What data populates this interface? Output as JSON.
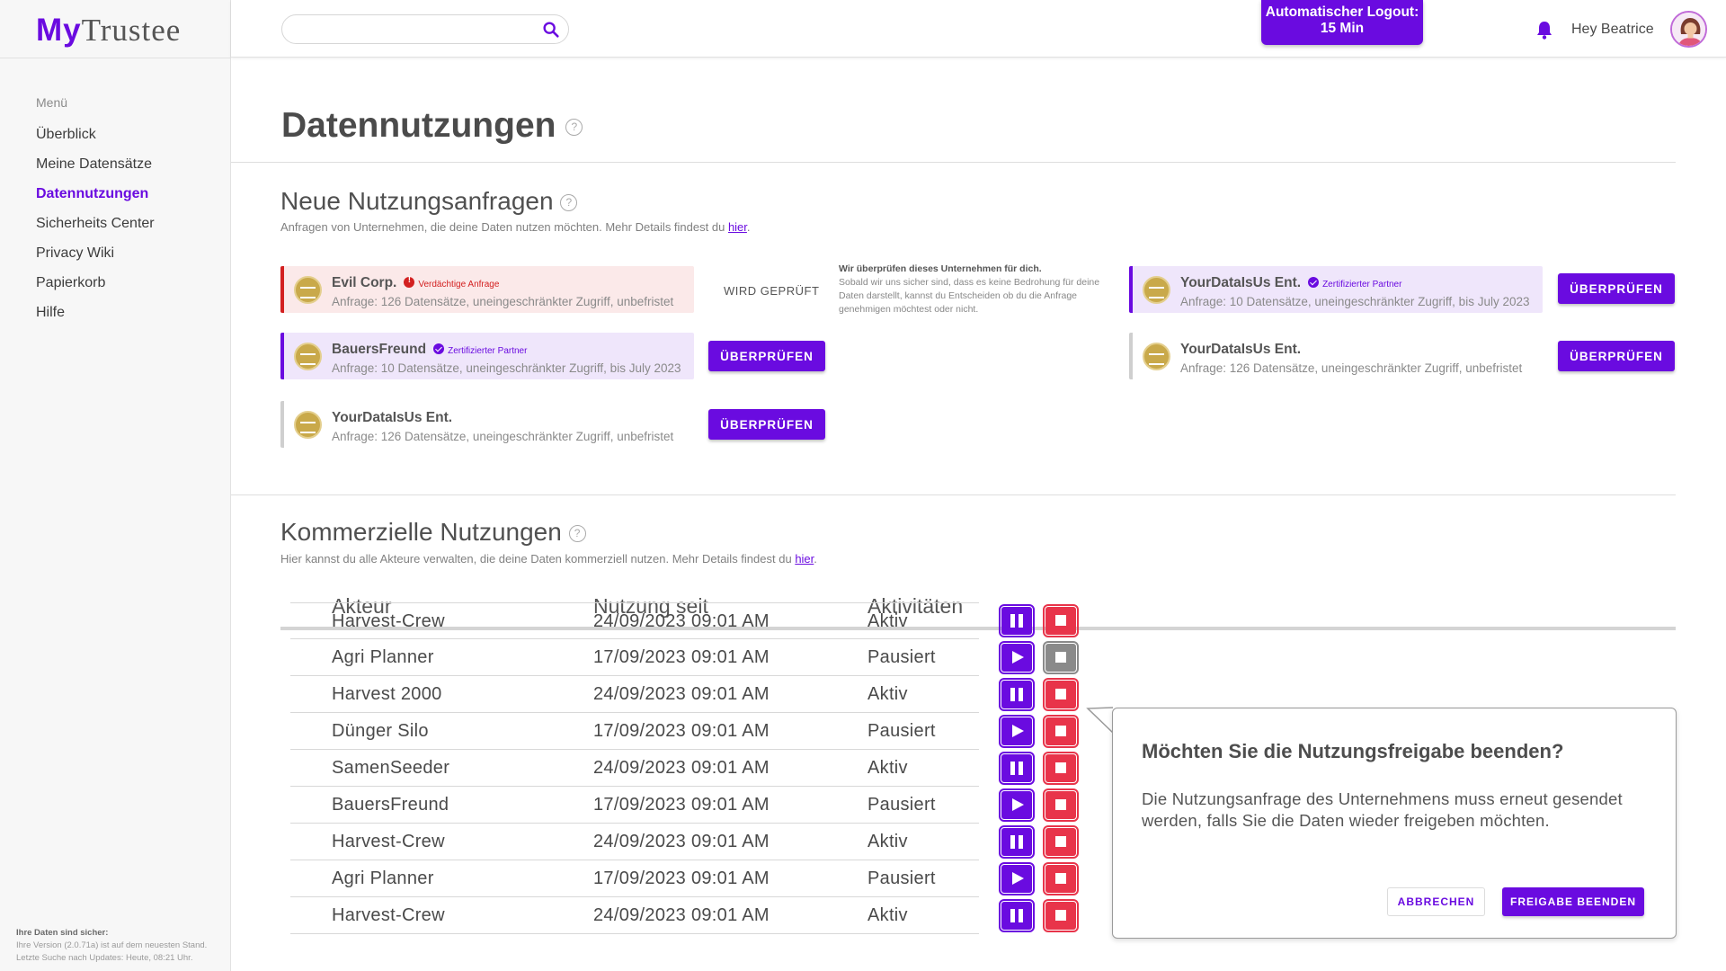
{
  "app": {
    "logo_my": "My",
    "logo_trustee": "Trustee"
  },
  "sidebar": {
    "menu_title": "Menü",
    "items": [
      {
        "label": "Überblick"
      },
      {
        "label": "Meine Datensätze"
      },
      {
        "label": "Datennutzungen"
      },
      {
        "label": "Sicherheits Center"
      },
      {
        "label": "Privacy Wiki"
      },
      {
        "label": "Papierkorb"
      },
      {
        "label": "Hilfe"
      }
    ],
    "active_item": "Datennutzungen",
    "footer": {
      "title": "Ihre Daten sind sicher:",
      "line1": "Ihre Version (2.0.71a) ist auf dem neuesten Stand.",
      "line2": "Letzte Suche nach Updates: Heute, 08:21 Uhr."
    }
  },
  "header": {
    "search_value": "",
    "search_icon": "search-icon",
    "logout_line1": "Automatischer Logout:",
    "logout_line2": "15 Min",
    "greeting": "Hey Beatrice",
    "bell_icon": "bell-icon"
  },
  "page": {
    "title": "Datennutzungen",
    "help": "?"
  },
  "requests": {
    "title": "Neue Nutzungsanfragen",
    "help": "?",
    "subtitle": "Anfragen von Unternehmen, die deine Daten nutzen möchten. Mehr Details findest du",
    "link": "hier",
    "subtitle_end": ".",
    "checking_label": "WIRD GEPRÜFT",
    "info_title": "Wir überprüfen dieses Unternehmen für dich.",
    "info_text": "Sobald wir uns sicher sind, dass es keine Bedrohung für deine Daten darstellt, kannst du Entscheiden ob du die Anfrage genehmigen möchtest oder nicht.",
    "button_label": "ÜBERPRÜFEN",
    "cards": [
      {
        "name": "Evil Corp.",
        "badge": "Verdächtige Anfrage",
        "badge_type": "warning",
        "desc": "Anfrage: 126 Datensätze, uneingeschränkter Zugriff, unbefristet"
      },
      {
        "name": "BauersFreund",
        "badge": "Zertifizierter Partner",
        "badge_type": "certified",
        "desc": "Anfrage: 10 Datensätze, uneingeschränkter Zugriff, bis July 2023"
      },
      {
        "name": "YourDataIsUs Ent.",
        "badge": "",
        "badge_type": "none",
        "desc": "Anfrage: 126 Datensätze, uneingeschränkter Zugriff, unbefristet"
      },
      {
        "name": "YourDataIsUs Ent.",
        "badge": "Zertifizierter Partner",
        "badge_type": "certified",
        "desc": "Anfrage: 10 Datensätze, uneingeschränkter Zugriff, bis July 2023"
      },
      {
        "name": "YourDataIsUs Ent.",
        "badge": "",
        "badge_type": "none",
        "desc": "Anfrage: 126 Datensätze, uneingeschränkter Zugriff, unbefristet"
      }
    ]
  },
  "commercial": {
    "title": "Kommerzielle Nutzungen",
    "help": "?",
    "subtitle": "Hier kannst du alle Akteure verwalten, die deine Daten kommerziell nutzen. Mehr Details findest du",
    "link": "hier",
    "subtitle_end": ".",
    "columns": [
      "Akteur",
      "Nutzung seit",
      "Aktivitäten"
    ],
    "rows": [
      {
        "actor": "Harvest-Crew",
        "since": "24/09/2023 09:01 AM",
        "status": "Aktiv"
      },
      {
        "actor": "Agri Planner",
        "since": "17/09/2023 09:01 AM",
        "status": "Pausiert"
      },
      {
        "actor": "Harvest 2000",
        "since": "24/09/2023 09:01 AM",
        "status": "Aktiv"
      },
      {
        "actor": "Dünger Silo",
        "since": "17/09/2023 09:01 AM",
        "status": "Pausiert"
      },
      {
        "actor": "SamenSeeder",
        "since": "24/09/2023 09:01 AM",
        "status": "Aktiv"
      },
      {
        "actor": "BauersFreund",
        "since": "17/09/2023 09:01 AM",
        "status": "Pausiert"
      },
      {
        "actor": "Harvest-Crew",
        "since": "24/09/2023 09:01 AM",
        "status": "Aktiv"
      },
      {
        "actor": "Agri Planner",
        "since": "17/09/2023 09:01 AM",
        "status": "Pausiert"
      },
      {
        "actor": "Harvest-Crew",
        "since": "24/09/2023 09:01 AM",
        "status": "Aktiv"
      }
    ]
  },
  "dialog": {
    "title": "Möchten Sie die Nutzungsfreigabe beenden?",
    "body": "Die Nutzungsanfrage des Unternehmens muss erneut gesendet werden, falls Sie die Daten wieder freigeben möchten.",
    "cancel": "ABBRECHEN",
    "confirm": "FREIGABE BEENDEN"
  },
  "colors": {
    "accent": "#6a0be0",
    "danger": "#e8344a",
    "warning": "#d32020"
  }
}
